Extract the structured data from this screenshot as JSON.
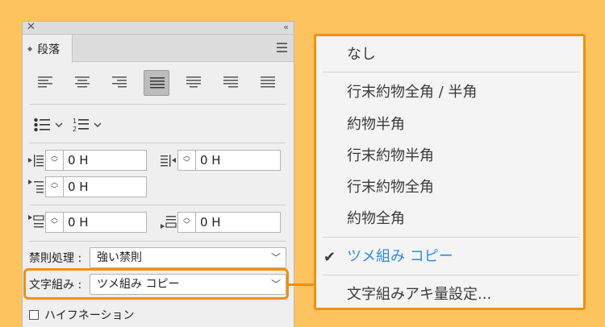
{
  "panel": {
    "close_glyph": "✕",
    "collapse_glyph": "‹‹",
    "tab_label": "段落",
    "alignment_buttons": [
      {
        "name": "align-left"
      },
      {
        "name": "align-center"
      },
      {
        "name": "align-right"
      },
      {
        "name": "justify-last-left",
        "active": true
      },
      {
        "name": "justify-last-center"
      },
      {
        "name": "justify-last-right"
      },
      {
        "name": "justify-all"
      }
    ],
    "indents": {
      "left_indent": "0 H",
      "right_indent": "0 H",
      "first_line_indent": "0 H",
      "space_before": "0 H",
      "space_after": "0 H"
    },
    "kinsoku": {
      "label": "禁則処理 :",
      "value": "強い禁則"
    },
    "mojikumi": {
      "label": "文字組み :",
      "value": "ツメ組み コピー"
    },
    "hyphenation": {
      "label": "ハイフネーション",
      "checked": false
    }
  },
  "dropdown": {
    "items": [
      {
        "label": "なし"
      },
      {
        "label": "行末約物全角 / 半角"
      },
      {
        "label": "約物半角"
      },
      {
        "label": "行末約物半角"
      },
      {
        "label": "行末約物全角"
      },
      {
        "label": "約物全角"
      },
      {
        "label": "ツメ組み コピー",
        "selected": true
      },
      {
        "label": "文字組みアキ量設定..."
      }
    ],
    "check_glyph": "✔"
  },
  "colors": {
    "background": "#FCC35F",
    "highlight": "#EF9012",
    "selected_text": "#2E8BEA"
  }
}
